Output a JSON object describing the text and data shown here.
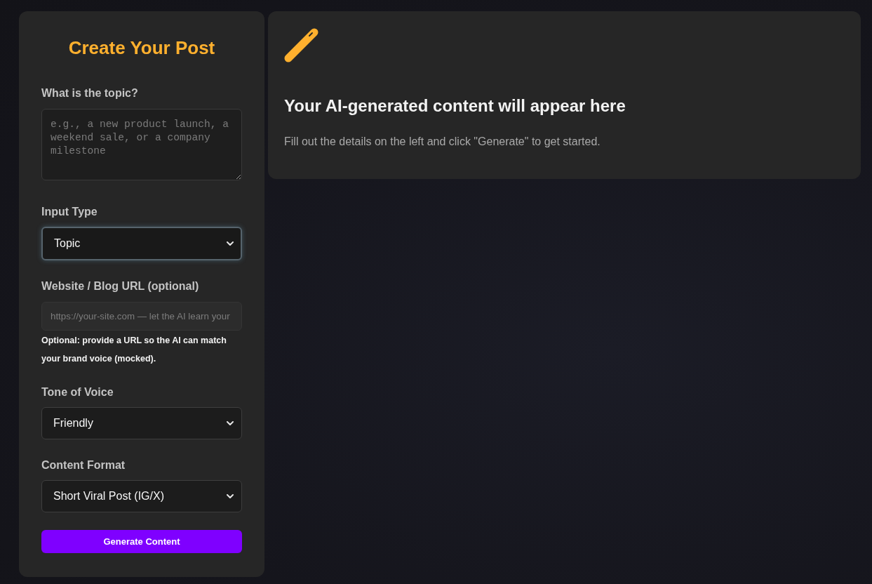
{
  "form": {
    "title": "Create Your Post",
    "fields": [
      {
        "kind": "textarea",
        "label": "What is the topic?",
        "placeholder": "e.g., a new product launch, a weekend sale, or a company milestone"
      },
      {
        "kind": "select",
        "label": "Input Type",
        "value": "Topic",
        "focused": true
      },
      {
        "kind": "input",
        "label": "Website / Blog URL (optional)",
        "placeholder": "https://your-site.com — let the AI learn your",
        "help": "Optional: provide a URL so the AI can match your brand voice (mocked)."
      },
      {
        "kind": "select",
        "label": "Tone of Voice",
        "value": "Friendly",
        "focused": false
      },
      {
        "kind": "select",
        "label": "Content Format",
        "value": "Short Viral Post (IG/X)",
        "focused": false
      }
    ],
    "button": "Generate Content"
  },
  "output": {
    "heading": "Your AI-generated content will appear here",
    "message": "Fill out the details on the left and click \"Generate\" to get started."
  }
}
